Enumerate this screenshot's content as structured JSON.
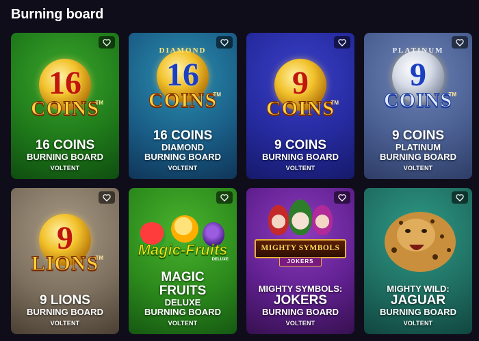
{
  "section": {
    "title": "Burning board"
  },
  "colors": {
    "page_bg": "#0f0d1a",
    "text": "#ffffff"
  },
  "cards": [
    {
      "name": "16-coins",
      "title": "16 COINS",
      "subtitle": "",
      "line3": "BURNING BOARD",
      "provider": "VOLTENT",
      "logo": {
        "number": "16",
        "word": "COINS",
        "arc": ""
      },
      "bg": "green"
    },
    {
      "name": "16-coins-diamond",
      "title": "16 COINS",
      "subtitle": "DIAMOND",
      "line3": "BURNING BOARD",
      "provider": "VOLTENT",
      "logo": {
        "number": "16",
        "word": "COINS",
        "arc": "DIAMOND"
      },
      "bg": "teal-blue"
    },
    {
      "name": "9-coins",
      "title": "9 COINS",
      "subtitle": "",
      "line3": "BURNING BOARD",
      "provider": "VOLTENT",
      "logo": {
        "number": "9",
        "word": "COINS",
        "arc": ""
      },
      "bg": "blue"
    },
    {
      "name": "9-coins-platinum",
      "title": "9 COINS",
      "subtitle": "PLATINUM",
      "line3": "BURNING BOARD",
      "provider": "VOLTENT",
      "logo": {
        "number": "9",
        "word": "COINS",
        "arc": "PLATINUM"
      },
      "bg": "steel-blue"
    },
    {
      "name": "9-lions",
      "title": "9 LIONS",
      "subtitle": "",
      "line3": "BURNING BOARD",
      "provider": "VOLTENT",
      "logo": {
        "number": "9",
        "word": "LIONS",
        "arc": ""
      },
      "bg": "tan"
    },
    {
      "name": "magic-fruits-deluxe",
      "title": "MAGIC",
      "title2": "FRUITS",
      "subtitle": "DELUXE",
      "line3": "BURNING BOARD",
      "provider": "VOLTENT",
      "logo": {
        "word": "Magic-Fruits",
        "sub": "DELUXE"
      },
      "bg": "green"
    },
    {
      "name": "mighty-symbols-jokers",
      "title": "MIGHTY SYMBOLS:",
      "title2": "JOKERS",
      "subtitle": "",
      "line3": "BURNING BOARD",
      "provider": "VOLTENT",
      "logo": {
        "word": "MIGHTY SYMBOLS",
        "sub": "JOKERS"
      },
      "bg": "purple"
    },
    {
      "name": "mighty-wild-jaguar",
      "title": "MIGHTY WILD:",
      "title2": "JAGUAR",
      "subtitle": "",
      "line3": "BURNING BOARD",
      "provider": "VOLTENT",
      "logo": {},
      "bg": "teal"
    }
  ],
  "icons": {
    "favorite": "heart-outline-icon"
  }
}
